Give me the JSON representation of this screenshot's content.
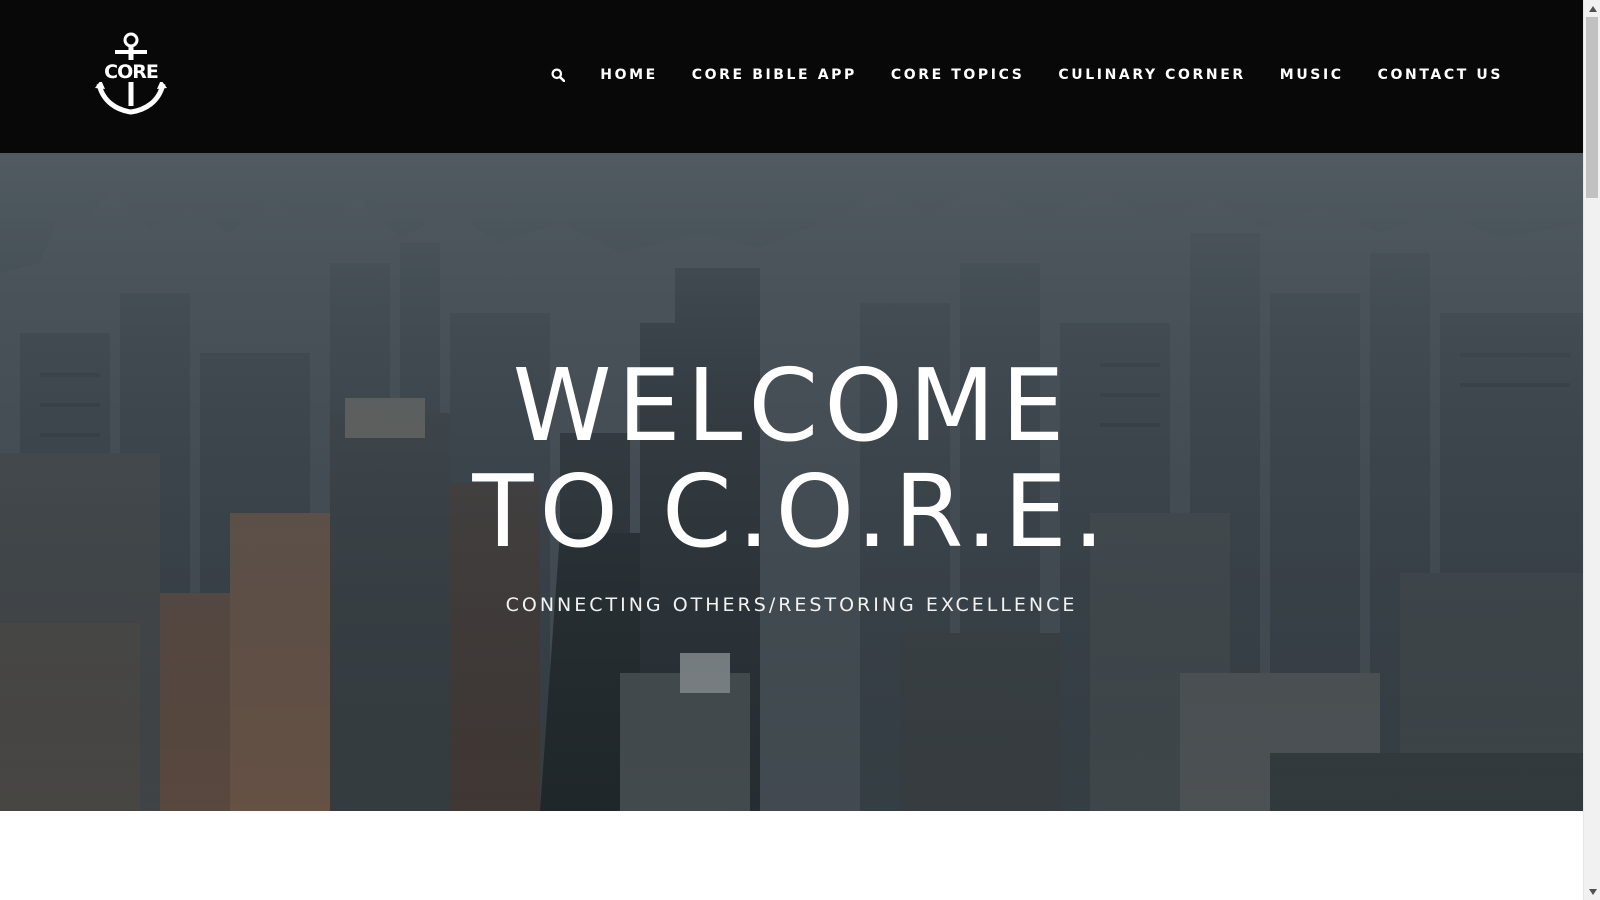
{
  "header": {
    "logo_text": "CORE",
    "logo_icon": "anchor-icon",
    "search_icon": "search-icon",
    "nav": [
      {
        "label": "HOME"
      },
      {
        "label": "CORE BIBLE APP"
      },
      {
        "label": "CORE TOPICS"
      },
      {
        "label": "CULINARY CORNER"
      },
      {
        "label": "MUSIC"
      },
      {
        "label": "CONTACT US"
      }
    ]
  },
  "hero": {
    "title_line1": "WELCOME",
    "title_line2": "TO C.O.R.E.",
    "subtitle": "CONNECTING OTHERS/RESTORING EXCELLENCE",
    "background": "aerial city skyline in fog"
  },
  "colors": {
    "header_bg": "#080808",
    "text": "#ffffff",
    "hero_tint": "#3a444a",
    "page_bg": "#ffffff"
  },
  "scrollbar": {
    "up_icon": "triangle-up-icon",
    "down_icon": "triangle-down-icon"
  }
}
